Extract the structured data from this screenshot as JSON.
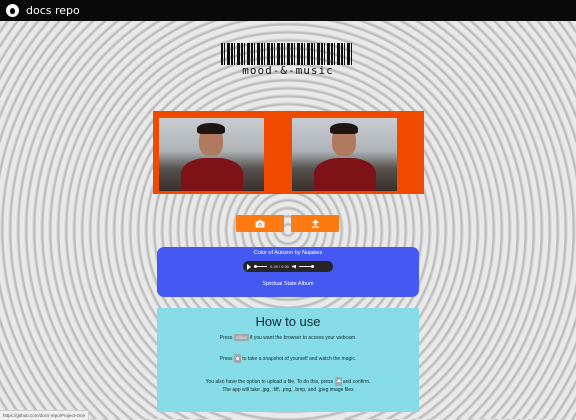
{
  "header": {
    "title": "docs repo",
    "icon": "github-icon"
  },
  "logo": {
    "text": "mood-&-music"
  },
  "camera": {
    "left_alt": "Webcam live view",
    "right_alt": "Snapshot preview"
  },
  "buttons": {
    "camera_icon": "camera-icon",
    "upload_icon": "upload-icon"
  },
  "player": {
    "song": "Color of Autumn by Nujabes",
    "time": "0:28 / 0:30",
    "album": "Spiritual State Album"
  },
  "howto": {
    "title": "How to use",
    "line1_pre": "Press",
    "line1_key": "Allow",
    "line1_post": "if you want the browser to access your webcam.",
    "line2_pre": "Press",
    "line2_post": "to take a snapshot of yourself and watch the magic.",
    "line3_pre": "You also have the option to upload a file. To do this, press",
    "line3_post": "and confirm.",
    "line4": "The app will take .jpg, .tiff, .png, .bmp, and .jpeg image files"
  },
  "status": {
    "url": "https://github.com/docs-repo/Project-One"
  },
  "colors": {
    "accent": "#ff7a11",
    "frame": "#f04a00",
    "player": "#4559f2",
    "howto": "#85dbe6"
  }
}
